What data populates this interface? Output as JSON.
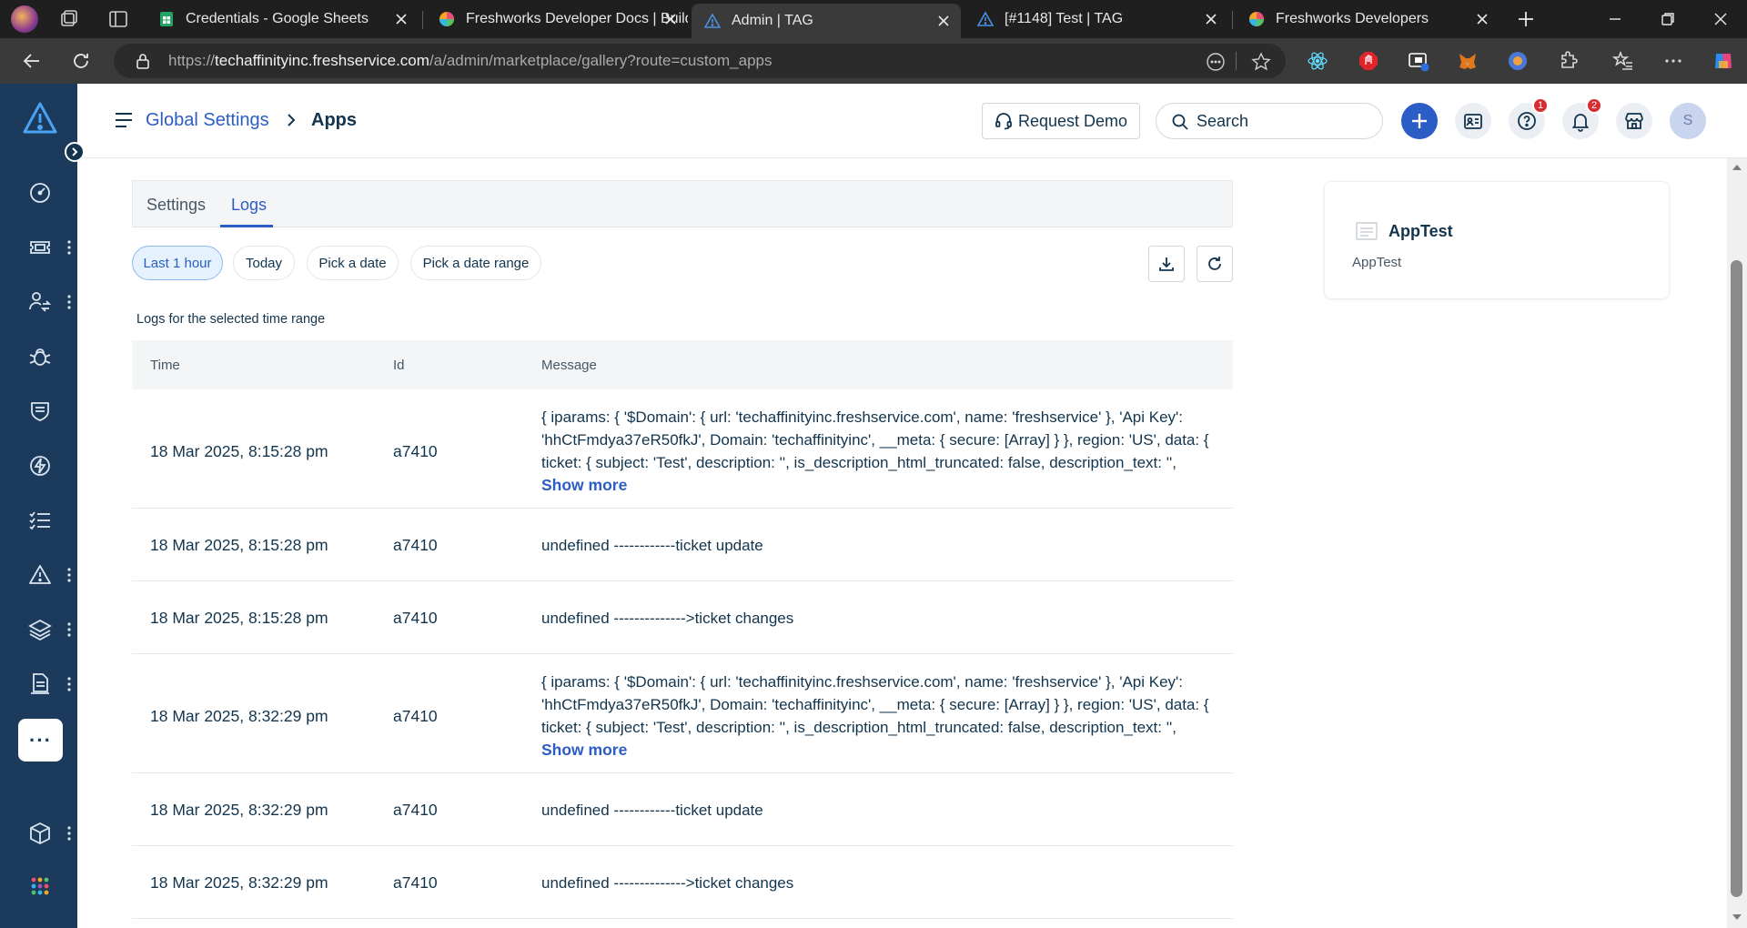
{
  "browser": {
    "tabs": [
      {
        "title": "Credentials - Google Sheets"
      },
      {
        "title": "Freshworks Developer Docs | Build"
      },
      {
        "title": "Admin | TAG"
      },
      {
        "title": "[#1148] Test | TAG"
      },
      {
        "title": "Freshworks Developers"
      }
    ],
    "url_scheme": "https://",
    "url_host": "techaffinityinc.freshservice.com",
    "url_path": "/a/admin/marketplace/gallery?route=custom_apps"
  },
  "header": {
    "breadcrumb_parent": "Global Settings",
    "breadcrumb_current": "Apps",
    "request_demo": "Request Demo",
    "search_placeholder": "Search",
    "help_badge": "1",
    "notifications_badge": "2",
    "avatar_initial": "S"
  },
  "tabs": {
    "settings": "Settings",
    "logs": "Logs"
  },
  "filters": {
    "last_hour": "Last 1 hour",
    "today": "Today",
    "pick_date": "Pick a date",
    "pick_range": "Pick a date range"
  },
  "logs": {
    "caption": "Logs for the selected time range",
    "columns": {
      "time": "Time",
      "id": "Id",
      "message": "Message"
    },
    "show_more": "Show more",
    "rows": [
      {
        "time": "18 Mar 2025, 8:15:28 pm",
        "id": "a7410",
        "message": "{ iparams: { '$Domain': { url: 'techaffinityinc.freshservice.com', name: 'freshservice' }, 'Api Key': 'hhCtFmdya37eR50fkJ', Domain: 'techaffinityinc', __meta: { secure: [Array] } }, region: 'US', data: { ticket: { subject: 'Test', description: '', is_description_html_truncated: false, description_text: '',"
      },
      {
        "time": "18 Mar 2025, 8:15:28 pm",
        "id": "a7410",
        "message": "undefined ------------ticket update"
      },
      {
        "time": "18 Mar 2025, 8:15:28 pm",
        "id": "a7410",
        "message": "undefined -------------->ticket changes"
      },
      {
        "time": "18 Mar 2025, 8:32:29 pm",
        "id": "a7410",
        "message": "{ iparams: { '$Domain': { url: 'techaffinityinc.freshservice.com', name: 'freshservice' }, 'Api Key': 'hhCtFmdya37eR50fkJ', Domain: 'techaffinityinc', __meta: { secure: [Array] } }, region: 'US', data: { ticket: { subject: 'Test', description: '', is_description_html_truncated: false, description_text: '',"
      },
      {
        "time": "18 Mar 2025, 8:32:29 pm",
        "id": "a7410",
        "message": "undefined ------------ticket update"
      },
      {
        "time": "18 Mar 2025, 8:32:29 pm",
        "id": "a7410",
        "message": "undefined -------------->ticket changes"
      }
    ]
  },
  "app_card": {
    "name": "AppTest",
    "description": "AppTest"
  },
  "icons": {
    "nav": [
      "dashboard-icon",
      "tickets-icon",
      "changes-icon",
      "problems-icon",
      "assets-icon",
      "releases-icon",
      "tasks-icon",
      "alerts-icon",
      "layers-icon",
      "reports-icon",
      "more-icon",
      "box-icon",
      "apps-grid-icon"
    ]
  },
  "colors": {
    "brand_nav": "#1b3a5c",
    "accent": "#2c5cc5",
    "badge": "#d72d30"
  }
}
